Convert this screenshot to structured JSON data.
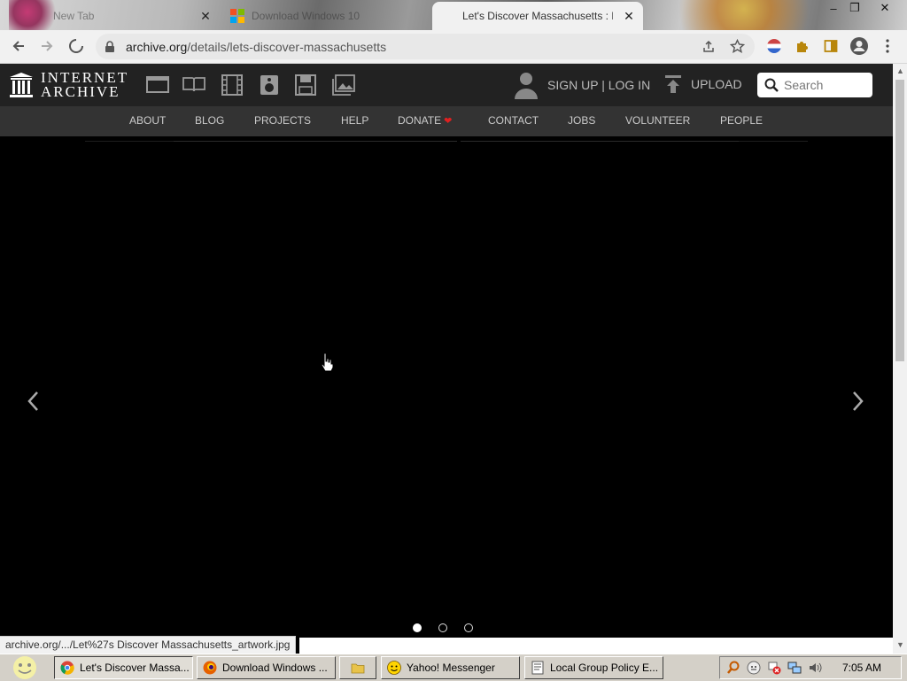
{
  "browser": {
    "tabs": [
      {
        "title": "New Tab",
        "active": false
      },
      {
        "title": "Download Windows 10",
        "active": false
      },
      {
        "title": "Let's Discover Massachusetts : Free",
        "active": true
      }
    ],
    "window_controls": {
      "minimize": "–",
      "maximize": "❐",
      "close": "✕"
    },
    "url_host": "archive.org",
    "url_path": "/details/lets-discover-massachusetts"
  },
  "ia": {
    "logo_line1": "INTERNET",
    "logo_line2": "ARCHIVE",
    "media_icons": [
      "web-icon",
      "texts-icon",
      "video-icon",
      "audio-icon",
      "software-icon",
      "images-icon"
    ],
    "signin_label": "SIGN UP | LOG IN",
    "upload_label": "UPLOAD",
    "search_placeholder": "Search",
    "nav": [
      "ABOUT",
      "BLOG",
      "PROJECTS",
      "HELP",
      "DONATE",
      "CONTACT",
      "JOBS",
      "VOLUNTEER",
      "PEOPLE"
    ]
  },
  "carousel": {
    "slide_count": 3,
    "active_slide": 1
  },
  "status_url": "archive.org/.../Let%27s Discover Massachusetts_artwork.jpg",
  "taskbar": {
    "items": [
      {
        "label": "Let's Discover Massa...",
        "icon": "chrome-icon",
        "pressed": true
      },
      {
        "label": "Download Windows ...",
        "icon": "firefox-icon",
        "pressed": false
      },
      {
        "label": "",
        "icon": "folder-icon",
        "pressed": false
      },
      {
        "label": "Yahoo! Messenger",
        "icon": "yahoo-messenger-icon",
        "pressed": false
      },
      {
        "label": "Local Group Policy E...",
        "icon": "policy-editor-icon",
        "pressed": false
      }
    ],
    "clock": "7:05 AM"
  },
  "colors": {
    "ia_header": "#222222",
    "ia_nav": "#333333",
    "donate_heart": "#e02020",
    "page_bg": "#000000"
  }
}
